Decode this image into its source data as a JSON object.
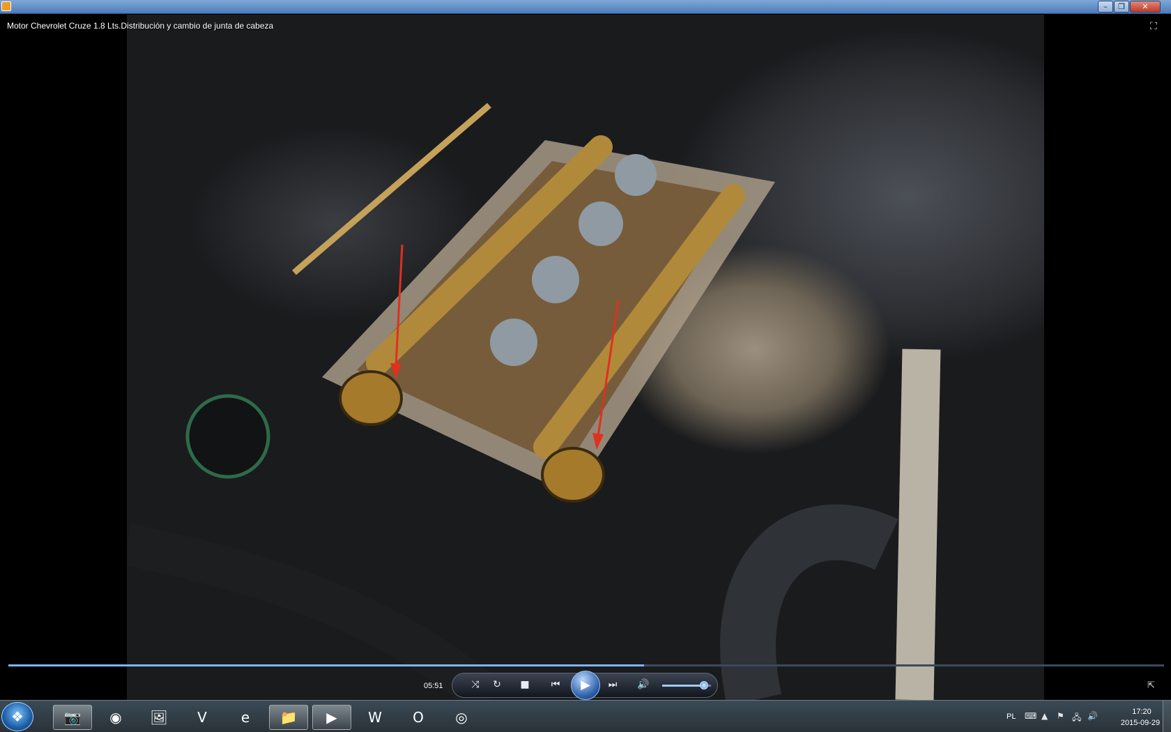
{
  "window": {
    "title_bar_buttons": {
      "minimize": "–",
      "maximize": "❐",
      "close": "✕"
    }
  },
  "video": {
    "title": "Motor Chevrolet Cruze 1.8 Lts.Distribución y cambio de junta de cabeza",
    "fullscreen_icon": "fullscreen-icon",
    "progress_fraction": 0.55
  },
  "controls": {
    "time": "05:51",
    "shuffle": "⤨",
    "repeat": "↻",
    "stop": "■",
    "previous": "⏮",
    "play": "▶",
    "next": "⏭",
    "volume_icon": "🔊",
    "volume_fraction": 0.85,
    "resize_icon": "⇱"
  },
  "taskbar": {
    "start_icon": "windows-logo-icon",
    "items": [
      {
        "name": "camera-app-icon",
        "glyph": "📷",
        "open": true
      },
      {
        "name": "opera-browser-icon",
        "glyph": "◉",
        "open": false
      },
      {
        "name": "photo-editor-icon",
        "glyph": "🖼",
        "open": false
      },
      {
        "name": "video-editor-icon",
        "glyph": "V",
        "open": false
      },
      {
        "name": "internet-explorer-icon",
        "glyph": "e",
        "open": false
      },
      {
        "name": "file-explorer-icon",
        "glyph": "📁",
        "open": true
      },
      {
        "name": "media-player-icon",
        "glyph": "▶",
        "open": true
      },
      {
        "name": "word-icon",
        "glyph": "W",
        "open": false
      },
      {
        "name": "outlook-icon",
        "glyph": "O",
        "open": false
      },
      {
        "name": "chrome-icon",
        "glyph": "◎",
        "open": false
      }
    ],
    "tray": {
      "language": "PL",
      "time": "17:20",
      "date": "2015-09-29"
    }
  }
}
